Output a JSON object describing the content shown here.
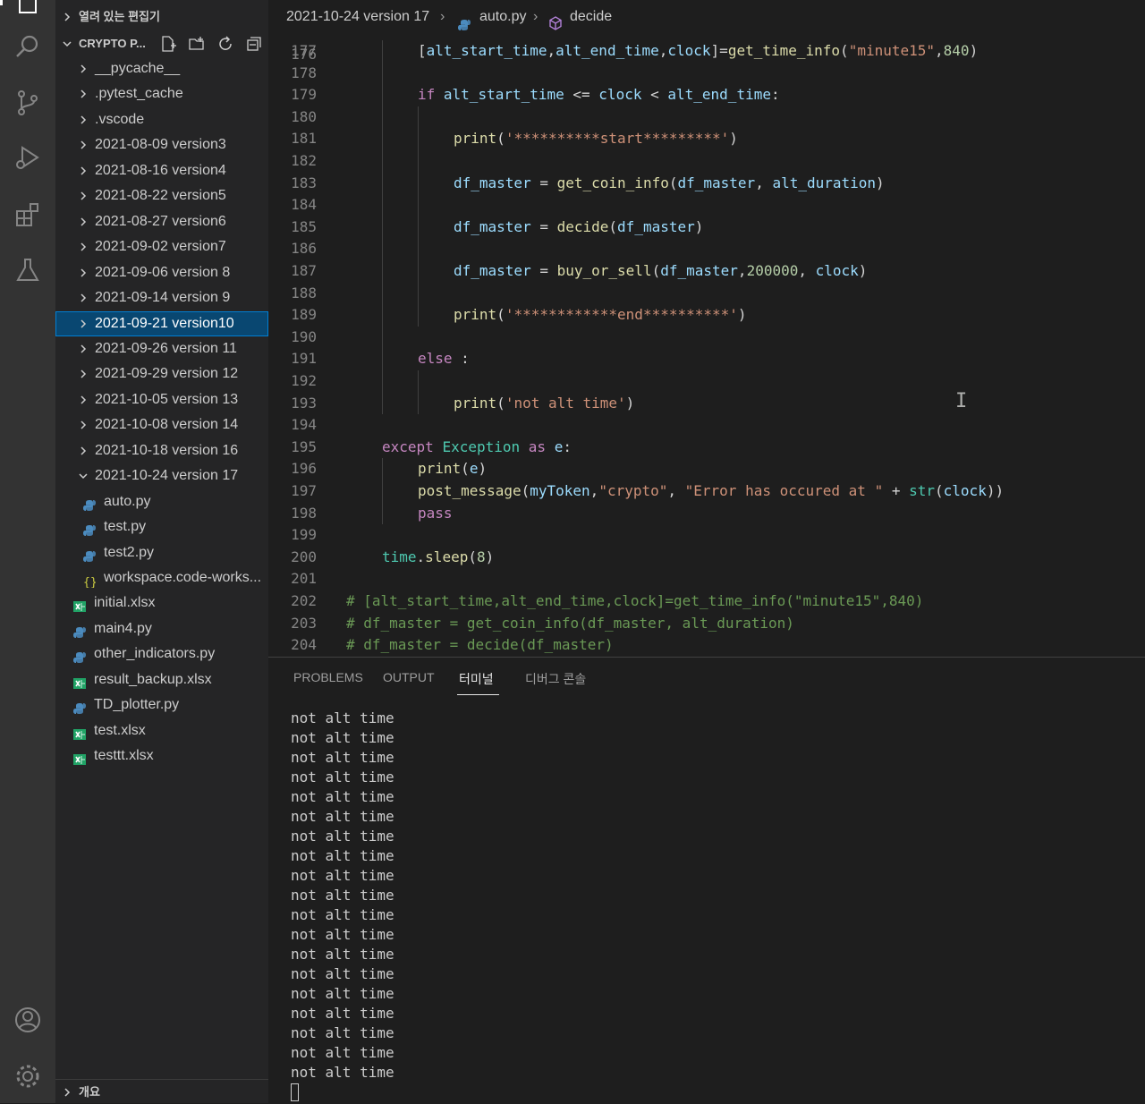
{
  "sidebar": {
    "open_editors_label": "열려 있는 편집기",
    "project_label": "CRYPTO P...",
    "outline_label": "개요",
    "tree": [
      {
        "label": "__pycache__",
        "type": "folder",
        "expanded": false,
        "depth": 1
      },
      {
        "label": ".pytest_cache",
        "type": "folder",
        "expanded": false,
        "depth": 1
      },
      {
        "label": ".vscode",
        "type": "folder",
        "expanded": false,
        "depth": 1
      },
      {
        "label": "2021-08-09 version3",
        "type": "folder",
        "expanded": false,
        "depth": 1
      },
      {
        "label": "2021-08-16 version4",
        "type": "folder",
        "expanded": false,
        "depth": 1
      },
      {
        "label": "2021-08-22 version5",
        "type": "folder",
        "expanded": false,
        "depth": 1
      },
      {
        "label": "2021-08-27 version6",
        "type": "folder",
        "expanded": false,
        "depth": 1
      },
      {
        "label": "2021-09-02 version7",
        "type": "folder",
        "expanded": false,
        "depth": 1
      },
      {
        "label": "2021-09-06 version 8",
        "type": "folder",
        "expanded": false,
        "depth": 1
      },
      {
        "label": "2021-09-14 version 9",
        "type": "folder",
        "expanded": false,
        "depth": 1
      },
      {
        "label": "2021-09-21 version10",
        "type": "folder",
        "expanded": false,
        "depth": 1,
        "selected": true
      },
      {
        "label": "2021-09-26 version 11",
        "type": "folder",
        "expanded": false,
        "depth": 1
      },
      {
        "label": "2021-09-29 version 12",
        "type": "folder",
        "expanded": false,
        "depth": 1
      },
      {
        "label": "2021-10-05 version 13",
        "type": "folder",
        "expanded": false,
        "depth": 1
      },
      {
        "label": "2021-10-08 version 14",
        "type": "folder",
        "expanded": false,
        "depth": 1
      },
      {
        "label": "2021-10-18 version 16",
        "type": "folder",
        "expanded": false,
        "depth": 1
      },
      {
        "label": "2021-10-24 version 17",
        "type": "folder",
        "expanded": true,
        "depth": 1
      },
      {
        "label": "auto.py",
        "type": "python",
        "depth": 2
      },
      {
        "label": "test.py",
        "type": "python",
        "depth": 2
      },
      {
        "label": "test2.py",
        "type": "python",
        "depth": 2
      },
      {
        "label": "workspace.code-works...",
        "type": "json",
        "depth": 2
      },
      {
        "label": "initial.xlsx",
        "type": "excel",
        "depth": 0
      },
      {
        "label": "main4.py",
        "type": "python",
        "depth": 0
      },
      {
        "label": "other_indicators.py",
        "type": "python",
        "depth": 0
      },
      {
        "label": "result_backup.xlsx",
        "type": "excel",
        "depth": 0
      },
      {
        "label": "TD_plotter.py",
        "type": "python",
        "depth": 0
      },
      {
        "label": "test.xlsx",
        "type": "excel",
        "depth": 0
      },
      {
        "label": "testtt.xlsx",
        "type": "excel",
        "depth": 0
      }
    ]
  },
  "breadcrumb": {
    "folder": "2021-10-24 version 17",
    "file": "auto.py",
    "symbol": "decide"
  },
  "editor": {
    "partial_top_line": "176",
    "lines": [
      {
        "n": "177",
        "indent": 2,
        "tokens": [
          [
            "op",
            "["
          ],
          [
            "var",
            "alt_start_time"
          ],
          [
            "op",
            ","
          ],
          [
            "var",
            "alt_end_time"
          ],
          [
            "op",
            ","
          ],
          [
            "var",
            "clock"
          ],
          [
            "op",
            "]="
          ],
          [
            "fn",
            "get_time_info"
          ],
          [
            "op",
            "("
          ],
          [
            "str",
            "\"minute15\""
          ],
          [
            "op",
            ","
          ],
          [
            "num",
            "840"
          ],
          [
            "op",
            ")"
          ]
        ]
      },
      {
        "n": "178",
        "indent": 2,
        "tokens": []
      },
      {
        "n": "179",
        "indent": 2,
        "tokens": [
          [
            "kw",
            "if"
          ],
          [
            "op",
            " "
          ],
          [
            "var",
            "alt_start_time"
          ],
          [
            "op",
            " <= "
          ],
          [
            "var",
            "clock"
          ],
          [
            "op",
            " < "
          ],
          [
            "var",
            "alt_end_time"
          ],
          [
            "op",
            ":"
          ]
        ]
      },
      {
        "n": "180",
        "indent": 3,
        "tokens": []
      },
      {
        "n": "181",
        "indent": 3,
        "tokens": [
          [
            "fn",
            "print"
          ],
          [
            "op",
            "("
          ],
          [
            "str",
            "'**********start*********'"
          ],
          [
            "op",
            ")"
          ]
        ]
      },
      {
        "n": "182",
        "indent": 3,
        "tokens": []
      },
      {
        "n": "183",
        "indent": 3,
        "tokens": [
          [
            "var",
            "df_master"
          ],
          [
            "op",
            " = "
          ],
          [
            "fn",
            "get_coin_info"
          ],
          [
            "op",
            "("
          ],
          [
            "var",
            "df_master"
          ],
          [
            "op",
            ", "
          ],
          [
            "var",
            "alt_duration"
          ],
          [
            "op",
            ")"
          ]
        ]
      },
      {
        "n": "184",
        "indent": 3,
        "tokens": []
      },
      {
        "n": "185",
        "indent": 3,
        "tokens": [
          [
            "var",
            "df_master"
          ],
          [
            "op",
            " = "
          ],
          [
            "fn",
            "decide"
          ],
          [
            "op",
            "("
          ],
          [
            "var",
            "df_master"
          ],
          [
            "op",
            ")"
          ]
        ]
      },
      {
        "n": "186",
        "indent": 3,
        "tokens": []
      },
      {
        "n": "187",
        "indent": 3,
        "tokens": [
          [
            "var",
            "df_master"
          ],
          [
            "op",
            " = "
          ],
          [
            "fn",
            "buy_or_sell"
          ],
          [
            "op",
            "("
          ],
          [
            "var",
            "df_master"
          ],
          [
            "op",
            ","
          ],
          [
            "num",
            "200000"
          ],
          [
            "op",
            ", "
          ],
          [
            "var",
            "clock"
          ],
          [
            "op",
            ")"
          ]
        ]
      },
      {
        "n": "188",
        "indent": 3,
        "tokens": []
      },
      {
        "n": "189",
        "indent": 3,
        "tokens": [
          [
            "fn",
            "print"
          ],
          [
            "op",
            "("
          ],
          [
            "str",
            "'************end**********'"
          ],
          [
            "op",
            ")"
          ]
        ]
      },
      {
        "n": "190",
        "indent": 2,
        "tokens": []
      },
      {
        "n": "191",
        "indent": 2,
        "tokens": [
          [
            "kw",
            "else"
          ],
          [
            "op",
            " :"
          ]
        ]
      },
      {
        "n": "192",
        "indent": 3,
        "tokens": []
      },
      {
        "n": "193",
        "indent": 3,
        "tokens": [
          [
            "fn",
            "print"
          ],
          [
            "op",
            "("
          ],
          [
            "str",
            "'not alt time'"
          ],
          [
            "op",
            ")"
          ]
        ]
      },
      {
        "n": "194",
        "indent": 1,
        "tokens": []
      },
      {
        "n": "195",
        "indent": 1,
        "tokens": [
          [
            "kw",
            "except"
          ],
          [
            "op",
            " "
          ],
          [
            "cls",
            "Exception"
          ],
          [
            "op",
            " "
          ],
          [
            "kw",
            "as"
          ],
          [
            "op",
            " "
          ],
          [
            "var",
            "e"
          ],
          [
            "op",
            ":"
          ]
        ]
      },
      {
        "n": "196",
        "indent": 2,
        "tokens": [
          [
            "fn",
            "print"
          ],
          [
            "op",
            "("
          ],
          [
            "var",
            "e"
          ],
          [
            "op",
            ")"
          ]
        ]
      },
      {
        "n": "197",
        "indent": 2,
        "tokens": [
          [
            "fn",
            "post_message"
          ],
          [
            "op",
            "("
          ],
          [
            "var",
            "myToken"
          ],
          [
            "op",
            ","
          ],
          [
            "str",
            "\"crypto\""
          ],
          [
            "op",
            ", "
          ],
          [
            "str",
            "\"Error has occured at \""
          ],
          [
            "op",
            " + "
          ],
          [
            "cls",
            "str"
          ],
          [
            "op",
            "("
          ],
          [
            "var",
            "clock"
          ],
          [
            "op",
            "))"
          ]
        ]
      },
      {
        "n": "198",
        "indent": 2,
        "tokens": [
          [
            "kw",
            "pass"
          ]
        ]
      },
      {
        "n": "199",
        "indent": 1,
        "tokens": []
      },
      {
        "n": "200",
        "indent": 1,
        "tokens": [
          [
            "cls",
            "time"
          ],
          [
            "op",
            "."
          ],
          [
            "fn",
            "sleep"
          ],
          [
            "op",
            "("
          ],
          [
            "num",
            "8"
          ],
          [
            "op",
            ")"
          ]
        ]
      },
      {
        "n": "201",
        "indent": 0,
        "tokens": []
      },
      {
        "n": "202",
        "indent": 0,
        "tokens": [
          [
            "cmt",
            "# [alt_start_time,alt_end_time,clock]=get_time_info(\"minute15\",840)"
          ]
        ]
      },
      {
        "n": "203",
        "indent": 0,
        "tokens": [
          [
            "cmt",
            "# df_master = get_coin_info(df_master, alt_duration)"
          ]
        ]
      },
      {
        "n": "204",
        "indent": 0,
        "tokens": [
          [
            "cmt",
            "# df_master = decide(df_master)"
          ]
        ]
      }
    ]
  },
  "panel": {
    "tabs": [
      {
        "label": "PROBLEMS",
        "active": false
      },
      {
        "label": "OUTPUT",
        "active": false
      },
      {
        "label": "터미널",
        "active": true
      },
      {
        "label": "디버그 콘솔",
        "active": false
      }
    ],
    "terminal_lines": [
      "not alt time",
      "not alt time",
      "not alt time",
      "not alt time",
      "not alt time",
      "not alt time",
      "not alt time",
      "not alt time",
      "not alt time",
      "not alt time",
      "not alt time",
      "not alt time",
      "not alt time",
      "not alt time",
      "not alt time",
      "not alt time",
      "not alt time",
      "not alt time",
      "not alt time"
    ]
  },
  "colors": {
    "selection": "#094771",
    "python_icon": "#4b8bbe",
    "excel_icon": "#21a366",
    "json_icon": "#cbcb41",
    "symbol_icon": "#b180d7"
  }
}
